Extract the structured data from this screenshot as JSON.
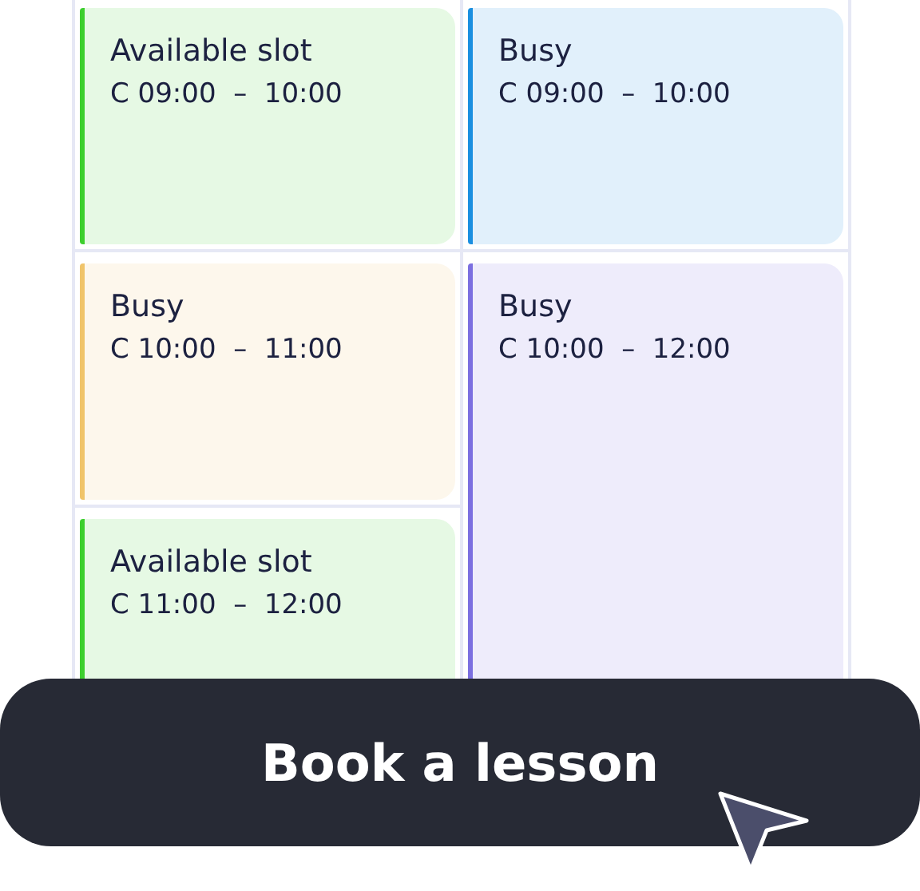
{
  "columns": [
    {
      "slots": [
        {
          "title": "Available slot",
          "time": "C 09:00  –  10:00",
          "color": "#3ccf2d",
          "kind": "short"
        },
        {
          "title": "Busy",
          "time": "C 10:00  –  11:00",
          "color": "#f0c46a",
          "kind": "short"
        },
        {
          "title": "Available slot",
          "time": "C 11:00  –  12:00",
          "color": "#3ccf2d",
          "kind": "short"
        }
      ]
    },
    {
      "slots": [
        {
          "title": "Busy",
          "time": "C 09:00  –  10:00",
          "color": "#1a8fe0",
          "kind": "short"
        },
        {
          "title": "Busy",
          "time": "C 10:00  –  12:00",
          "color": "#7b6fe0",
          "kind": "long"
        }
      ]
    }
  ],
  "button": {
    "label": "Book a lesson"
  }
}
